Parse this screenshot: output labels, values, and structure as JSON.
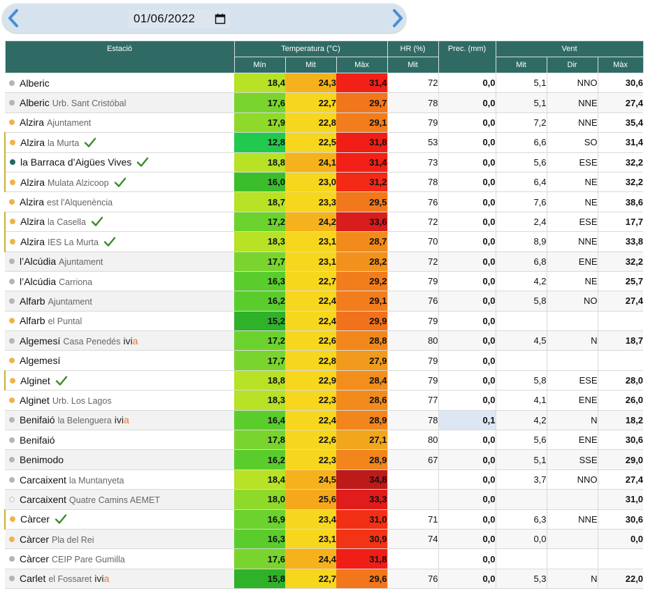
{
  "date": {
    "value": "01/06/2022"
  },
  "headers": {
    "station": "Estació",
    "temperature": "Temperatura (°C)",
    "hr": "HR (%)",
    "prec": "Prec. (mm)",
    "wind": "Vent",
    "min": "Mín",
    "mit": "Mit",
    "max": "Màx",
    "hr_mit": "Mit",
    "wind_mit": "Mit",
    "wind_dir": "Dir",
    "wind_max": "Màx"
  },
  "colors": {
    "header_bg": "#2f6b64",
    "datebar_bg": "#d6e3ef",
    "arrow": "#4a90d0",
    "check": "#3d8a2c",
    "ivia_a": "#e8762d"
  },
  "rows": [
    {
      "name": "Alberic",
      "sub": "",
      "dot": "g",
      "check": false,
      "ivia": false,
      "hl": false,
      "tmin": "18,4",
      "tmit": "24,3",
      "tmax": "31,4",
      "hr": "72",
      "prec": "0,0",
      "wmit": "5,1",
      "wdir": "NNO",
      "wmax": "30,6",
      "cmin": "#b8e226",
      "cmit": "#f6b21c",
      "cmax": "#f22016"
    },
    {
      "name": "Alberic",
      "sub": "Urb. Sant Cristóbal",
      "dot": "g",
      "check": false,
      "ivia": false,
      "hl": false,
      "tmin": "17,6",
      "tmit": "22,7",
      "tmax": "29,7",
      "hr": "78",
      "prec": "0,0",
      "wmit": "5,1",
      "wdir": "NNE",
      "wmax": "27,4",
      "cmin": "#79d52e",
      "cmit": "#f7d61e",
      "cmax": "#f2771c"
    },
    {
      "name": "Alzira",
      "sub": "Ajuntament",
      "dot": "o",
      "check": false,
      "ivia": false,
      "hl": false,
      "tmin": "17,9",
      "tmit": "22,8",
      "tmax": "29,1",
      "hr": "79",
      "prec": "0,0",
      "wmit": "7,2",
      "wdir": "NNE",
      "wmax": "35,4",
      "cmin": "#8fd92b",
      "cmit": "#f7d61e",
      "cmax": "#f27d1c"
    },
    {
      "name": "Alzira",
      "sub": "la Murta",
      "dot": "o",
      "check": true,
      "ivia": false,
      "hl": true,
      "tmin": "12,8",
      "tmit": "22,5",
      "tmax": "31,8",
      "hr": "53",
      "prec": "0,0",
      "wmit": "6,6",
      "wdir": "SO",
      "wmax": "31,4",
      "cmin": "#21c94e",
      "cmit": "#f7d61e",
      "cmax": "#f01e16"
    },
    {
      "name": "la Barraca d’Aigües Vives",
      "sub": "",
      "dot": "t",
      "check": true,
      "ivia": false,
      "hl": true,
      "tmin": "18,8",
      "tmit": "24,1",
      "tmax": "31,4",
      "hr": "73",
      "prec": "0,0",
      "wmit": "5,6",
      "wdir": "ESE",
      "wmax": "32,2",
      "cmin": "#b8e226",
      "cmit": "#f6b21c",
      "cmax": "#f22016"
    },
    {
      "name": "Alzira",
      "sub": "Mulata Alzicoop",
      "dot": "o",
      "check": true,
      "ivia": false,
      "hl": true,
      "tmin": "16,0",
      "tmit": "23,0",
      "tmax": "31,2",
      "hr": "78",
      "prec": "0,0",
      "wmit": "6,4",
      "wdir": "NE",
      "wmax": "32,2",
      "cmin": "#3cbe2c",
      "cmit": "#f7d61e",
      "cmax": "#f22a16"
    },
    {
      "name": "Alzira",
      "sub": "est l'Alquenència",
      "dot": "o",
      "check": false,
      "ivia": false,
      "hl": false,
      "tmin": "18,7",
      "tmit": "23,3",
      "tmax": "29,5",
      "hr": "76",
      "prec": "0,0",
      "wmit": "7,6",
      "wdir": "NE",
      "wmax": "38,6",
      "cmin": "#b8e226",
      "cmit": "#f7d61e",
      "cmax": "#f2781c"
    },
    {
      "name": "Alzira",
      "sub": "la Casella",
      "dot": "o",
      "check": true,
      "ivia": false,
      "hl": true,
      "tmin": "17,2",
      "tmit": "24,2",
      "tmax": "33,6",
      "hr": "72",
      "prec": "0,0",
      "wmit": "2,4",
      "wdir": "ESE",
      "wmax": "17,7",
      "cmin": "#6cd22d",
      "cmit": "#f6b21c",
      "cmax": "#d91c1c"
    },
    {
      "name": "Alzira",
      "sub": "IES La Murta",
      "dot": "o",
      "check": true,
      "ivia": false,
      "hl": true,
      "tmin": "18,3",
      "tmit": "23,1",
      "tmax": "28,7",
      "hr": "70",
      "prec": "0,0",
      "wmit": "8,9",
      "wdir": "NNE",
      "wmax": "33,8",
      "cmin": "#b8e226",
      "cmit": "#f7d61e",
      "cmax": "#f28a1c"
    },
    {
      "name": "l’Alcúdia",
      "sub": "Ajuntament",
      "dot": "g",
      "check": false,
      "ivia": false,
      "hl": false,
      "tmin": "17,7",
      "tmit": "23,1",
      "tmax": "28,2",
      "hr": "72",
      "prec": "0,0",
      "wmit": "6,8",
      "wdir": "ENE",
      "wmax": "32,2",
      "cmin": "#79d52e",
      "cmit": "#f7d61e",
      "cmax": "#f2911c"
    },
    {
      "name": "l’Alcúdia",
      "sub": "Carriona",
      "dot": "g",
      "check": false,
      "ivia": false,
      "hl": false,
      "tmin": "16,3",
      "tmit": "22,7",
      "tmax": "29,2",
      "hr": "79",
      "prec": "0,0",
      "wmit": "4,2",
      "wdir": "NE",
      "wmax": "25,7",
      "cmin": "#5acd2d",
      "cmit": "#f7d61e",
      "cmax": "#f27d1c"
    },
    {
      "name": "Alfarb",
      "sub": "Ajuntament",
      "dot": "g",
      "check": false,
      "ivia": false,
      "hl": false,
      "tmin": "16,2",
      "tmit": "22,4",
      "tmax": "29,1",
      "hr": "76",
      "prec": "0,0",
      "wmit": "5,8",
      "wdir": "NO",
      "wmax": "27,4",
      "cmin": "#5acd2d",
      "cmit": "#f7d61e",
      "cmax": "#f27d1c"
    },
    {
      "name": "Alfarb",
      "sub": "el Puntal",
      "dot": "o",
      "check": false,
      "ivia": false,
      "hl": false,
      "tmin": "15,2",
      "tmit": "22,4",
      "tmax": "29,9",
      "hr": "79",
      "prec": "0,0",
      "wmit": "",
      "wdir": "",
      "wmax": "",
      "cmin": "#2fb22a",
      "cmit": "#f7d61e",
      "cmax": "#f2721c"
    },
    {
      "name": "Algemesí",
      "sub": "Casa Penedés",
      "dot": "g",
      "check": false,
      "ivia": true,
      "hl": false,
      "tmin": "17,2",
      "tmit": "22,6",
      "tmax": "28,8",
      "hr": "80",
      "prec": "0,0",
      "wmit": "4,5",
      "wdir": "N",
      "wmax": "18,7",
      "cmin": "#6cd22d",
      "cmit": "#f7d61e",
      "cmax": "#f2881c"
    },
    {
      "name": "Algemesí",
      "sub": "",
      "dot": "o",
      "check": false,
      "ivia": false,
      "hl": false,
      "tmin": "17,7",
      "tmit": "22,8",
      "tmax": "27,9",
      "hr": "79",
      "prec": "0,0",
      "wmit": "",
      "wdir": "",
      "wmax": "",
      "cmin": "#79d52e",
      "cmit": "#f7d61e",
      "cmax": "#f29a1c"
    },
    {
      "name": "Alginet",
      "sub": "",
      "dot": "o",
      "check": true,
      "ivia": false,
      "hl": true,
      "tmin": "18,8",
      "tmit": "22,9",
      "tmax": "28,4",
      "hr": "79",
      "prec": "0,0",
      "wmit": "5,8",
      "wdir": "ESE",
      "wmax": "28,0",
      "cmin": "#b8e226",
      "cmit": "#f7d61e",
      "cmax": "#f28e1c"
    },
    {
      "name": "Alginet",
      "sub": "Urb. Los Lagos",
      "dot": "o",
      "check": false,
      "ivia": false,
      "hl": false,
      "tmin": "18,3",
      "tmit": "22,3",
      "tmax": "28,6",
      "hr": "77",
      "prec": "0,0",
      "wmit": "4,1",
      "wdir": "ENE",
      "wmax": "26,0",
      "cmin": "#b8e226",
      "cmit": "#f7d61e",
      "cmax": "#f28b1c"
    },
    {
      "name": "Benifaió",
      "sub": "la Belenguera",
      "dot": "g",
      "check": false,
      "ivia": true,
      "hl": false,
      "tmin": "16,4",
      "tmit": "22,4",
      "tmax": "28,9",
      "hr": "78",
      "prec": "0,1",
      "wmit": "4,2",
      "wdir": "N",
      "wmax": "18,2",
      "cmin": "#5acd2d",
      "cmit": "#f7d61e",
      "cmax": "#f2851c"
    },
    {
      "name": "Benifaió",
      "sub": "",
      "dot": "g",
      "check": false,
      "ivia": false,
      "hl": false,
      "tmin": "17,8",
      "tmit": "22,6",
      "tmax": "27,1",
      "hr": "80",
      "prec": "0,0",
      "wmit": "5,6",
      "wdir": "ENE",
      "wmax": "30,6",
      "cmin": "#79d52e",
      "cmit": "#f7d61e",
      "cmax": "#f2a61c"
    },
    {
      "name": "Benimodo",
      "sub": "",
      "dot": "g",
      "check": false,
      "ivia": false,
      "hl": false,
      "tmin": "16,2",
      "tmit": "22,3",
      "tmax": "28,9",
      "hr": "67",
      "prec": "0,0",
      "wmit": "5,1",
      "wdir": "SSE",
      "wmax": "29,0",
      "cmin": "#5acd2d",
      "cmit": "#f7d61e",
      "cmax": "#f2851c"
    },
    {
      "name": "Carcaixent",
      "sub": "la Muntanyeta",
      "dot": "g",
      "check": false,
      "ivia": false,
      "hl": false,
      "tmin": "18,4",
      "tmit": "24,5",
      "tmax": "34,8",
      "hr": "",
      "prec": "0,0",
      "wmit": "3,7",
      "wdir": "NNO",
      "wmax": "27,4",
      "cmin": "#b8e226",
      "cmit": "#f6b21c",
      "cmax": "#bd1a1a"
    },
    {
      "name": "Carcaixent",
      "sub": "Quatre Camins AEMET",
      "dot": "d",
      "check": false,
      "ivia": false,
      "hl": false,
      "tmin": "18,0",
      "tmit": "25,6",
      "tmax": "33,3",
      "hr": "",
      "prec": "0,0",
      "wmit": "",
      "wdir": "",
      "wmax": "31,0",
      "cmin": "#8fd92b",
      "cmit": "#f6a81c",
      "cmax": "#e01c1c"
    },
    {
      "name": "Càrcer",
      "sub": "",
      "dot": "o",
      "check": true,
      "ivia": false,
      "hl": true,
      "tmin": "16,9",
      "tmit": "23,4",
      "tmax": "31,0",
      "hr": "71",
      "prec": "0,0",
      "wmit": "6,3",
      "wdir": "NNE",
      "wmax": "30,6",
      "cmin": "#6cd22d",
      "cmit": "#f7d61e",
      "cmax": "#f23016"
    },
    {
      "name": "Càrcer",
      "sub": "Pla del Rei",
      "dot": "o",
      "check": false,
      "ivia": false,
      "hl": false,
      "tmin": "16,3",
      "tmit": "23,1",
      "tmax": "30,9",
      "hr": "74",
      "prec": "0,0",
      "wmit": "0,0",
      "wdir": "",
      "wmax": "0,0",
      "cmin": "#5acd2d",
      "cmit": "#f7d61e",
      "cmax": "#f23316"
    },
    {
      "name": "Càrcer",
      "sub": "CEIP Pare Gumilla",
      "dot": "g",
      "check": false,
      "ivia": false,
      "hl": false,
      "tmin": "17,6",
      "tmit": "24,4",
      "tmax": "31,8",
      "hr": "",
      "prec": "0,0",
      "wmit": "",
      "wdir": "",
      "wmax": "",
      "cmin": "#79d52e",
      "cmit": "#f6b21c",
      "cmax": "#f01e16"
    },
    {
      "name": "Carlet",
      "sub": "el Fossaret",
      "dot": "g",
      "check": false,
      "ivia": true,
      "hl": false,
      "tmin": "15,8",
      "tmit": "22,7",
      "tmax": "29,6",
      "hr": "76",
      "prec": "0,0",
      "wmit": "5,3",
      "wdir": "N",
      "wmax": "22,0",
      "cmin": "#2fb22a",
      "cmit": "#f7d61e",
      "cmax": "#f2771c"
    }
  ],
  "ivia_label": {
    "prefix": "ivi",
    "suffix": "a"
  }
}
